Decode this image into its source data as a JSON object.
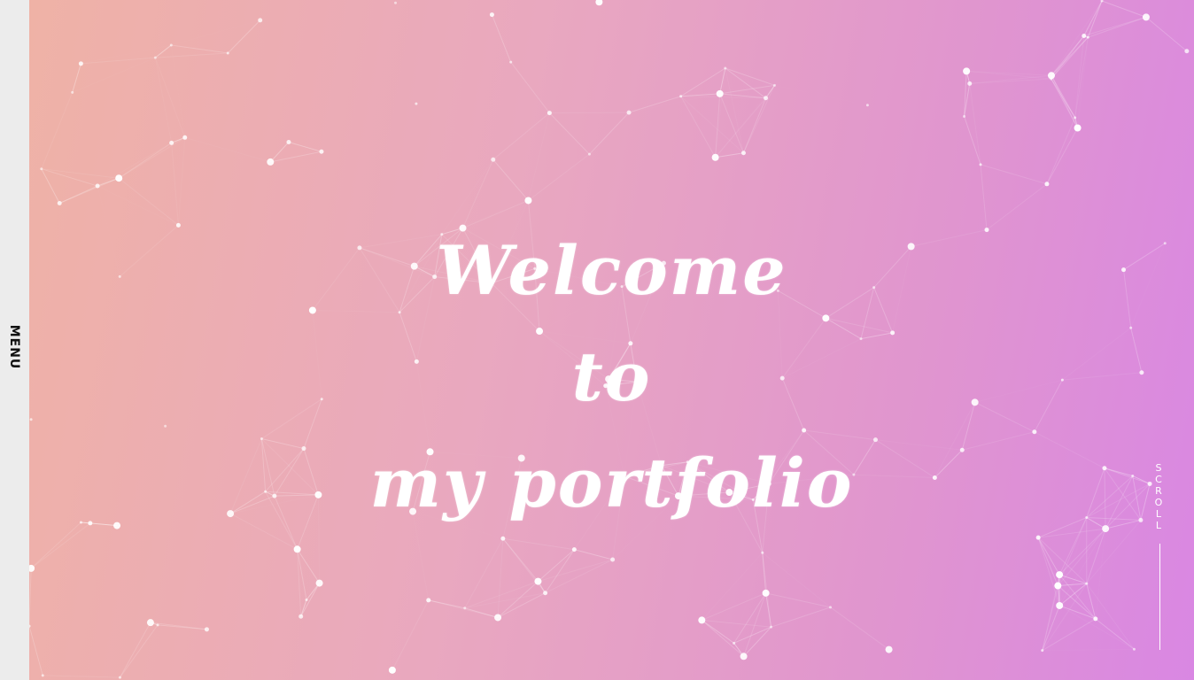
{
  "sidebar": {
    "menu_label": "MENU"
  },
  "hero": {
    "headline_lines": [
      "Welcome",
      "to",
      "my portfolio"
    ],
    "scroll_label": "SCROLL"
  },
  "colors": {
    "gradient_start": "#efb2a6",
    "gradient_end": "#d987e3",
    "sidebar_bg": "#ececec",
    "text": "#ffffff"
  }
}
